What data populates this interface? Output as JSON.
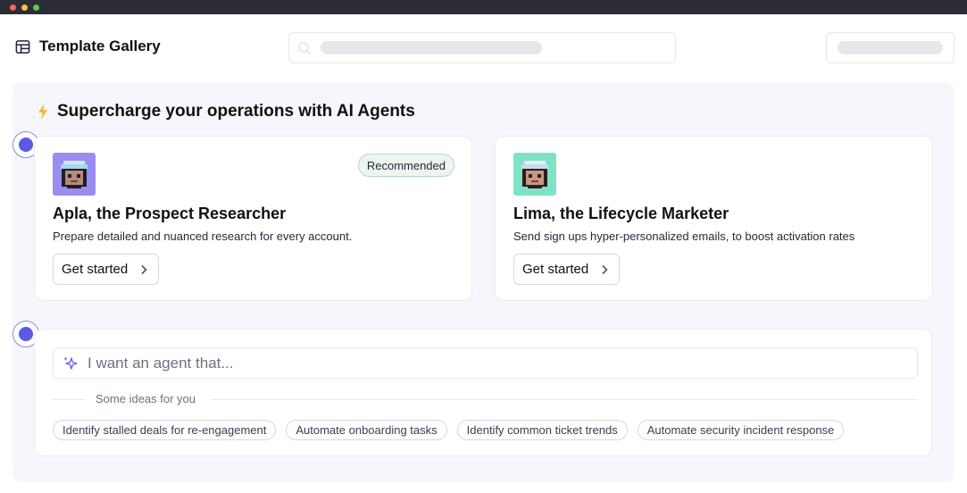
{
  "window": {
    "traffic_lights": [
      "#ed6a5e",
      "#f5bf4f",
      "#61c554"
    ]
  },
  "header": {
    "title": "Template Gallery",
    "icon": "gallery-icon"
  },
  "section": {
    "icon": "lightning-icon",
    "title": "Supercharge your operations with AI Agents"
  },
  "agents": [
    {
      "name": "Apla, the Prospect Researcher",
      "description": "Prepare detailed and nuanced research for every account.",
      "cta": "Get started",
      "badge": "Recommended",
      "avatar_bg": "#9b8cf0"
    },
    {
      "name": "Lima, the Lifecycle Marketer",
      "description": "Send sign ups hyper-personalized emails, to boost activation rates",
      "cta": "Get started",
      "avatar_bg": "#7ee3c6"
    }
  ],
  "prompt": {
    "placeholder": "I want an agent that...",
    "ideas_label": "Some ideas for you",
    "ideas": [
      "Identify stalled deals for re-engagement",
      "Automate onboarding tasks",
      "Identify common ticket trends",
      "Automate security incident response"
    ]
  },
  "colors": {
    "accent": "#5b5ae6",
    "badge_bg": "#eef5ee",
    "panel_bg": "#f6f7fc"
  }
}
